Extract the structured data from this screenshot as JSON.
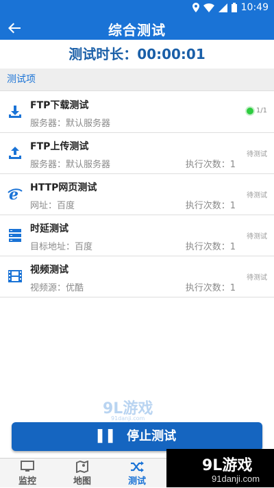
{
  "status_bar": {
    "time": "10:49",
    "icons": [
      "location-icon",
      "wifi-icon",
      "signal-icon",
      "battery-icon"
    ]
  },
  "app_bar": {
    "title": "综合测试",
    "back_icon": "arrow-left-icon"
  },
  "duration": {
    "text": "测试时长：00:00:01"
  },
  "section": {
    "title": "测试项"
  },
  "tests": [
    {
      "icon": "download-icon",
      "name": "FTP下载测试",
      "sub": "服务器：默认服务器",
      "count": "",
      "status": "1/1",
      "running": true
    },
    {
      "icon": "upload-icon",
      "name": "FTP上传测试",
      "sub": "服务器：默认服务器",
      "count": "执行次数：1",
      "status": "待测试",
      "running": false
    },
    {
      "icon": "browser-e-icon",
      "name": "HTTP网页测试",
      "sub": "网址：百度",
      "count": "执行次数：1",
      "status": "待测试",
      "running": false
    },
    {
      "icon": "server-stack-icon",
      "name": "时延测试",
      "sub": "目标地址：百度",
      "count": "执行次数：1",
      "status": "待测试",
      "running": false
    },
    {
      "icon": "film-icon",
      "name": "视频测试",
      "sub": "视频源：优酷",
      "count": "执行次数：1",
      "status": "待测试",
      "running": false
    }
  ],
  "stop_button": {
    "label": "停止测试",
    "icon": "pause-icon"
  },
  "watermark": {
    "text": "9L游戏",
    "site": "91danji.com"
  },
  "tabs": [
    {
      "label": "监控",
      "icon": "monitor-icon",
      "active": false
    },
    {
      "label": "地图",
      "icon": "map-icon",
      "active": false
    },
    {
      "label": "测试",
      "icon": "shuffle-icon",
      "active": true
    }
  ],
  "corner_logo": {
    "text": "9L游戏",
    "site": "91danji.com"
  },
  "colors": {
    "primary": "#1a73d6",
    "button": "#1565c0",
    "running_dot": "#2ecc40"
  }
}
